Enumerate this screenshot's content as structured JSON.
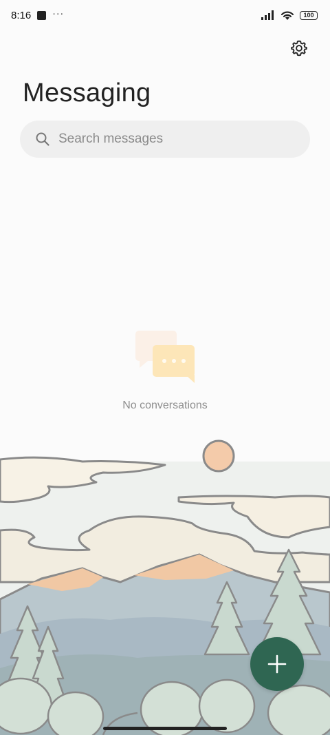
{
  "status_bar": {
    "time": "8:16",
    "more_indicator": "···",
    "battery": "100"
  },
  "header": {
    "title": "Messaging",
    "settings_icon": "gear-icon"
  },
  "search": {
    "placeholder": "Search messages",
    "icon": "search-icon"
  },
  "empty_state": {
    "text": "No conversations",
    "icon": "chat-bubbles-icon"
  },
  "fab": {
    "icon": "plus-icon",
    "color": "#2f6652"
  },
  "colors": {
    "background": "#fbfbfb",
    "search_background": "#efefef",
    "accent": "#2f6652"
  }
}
